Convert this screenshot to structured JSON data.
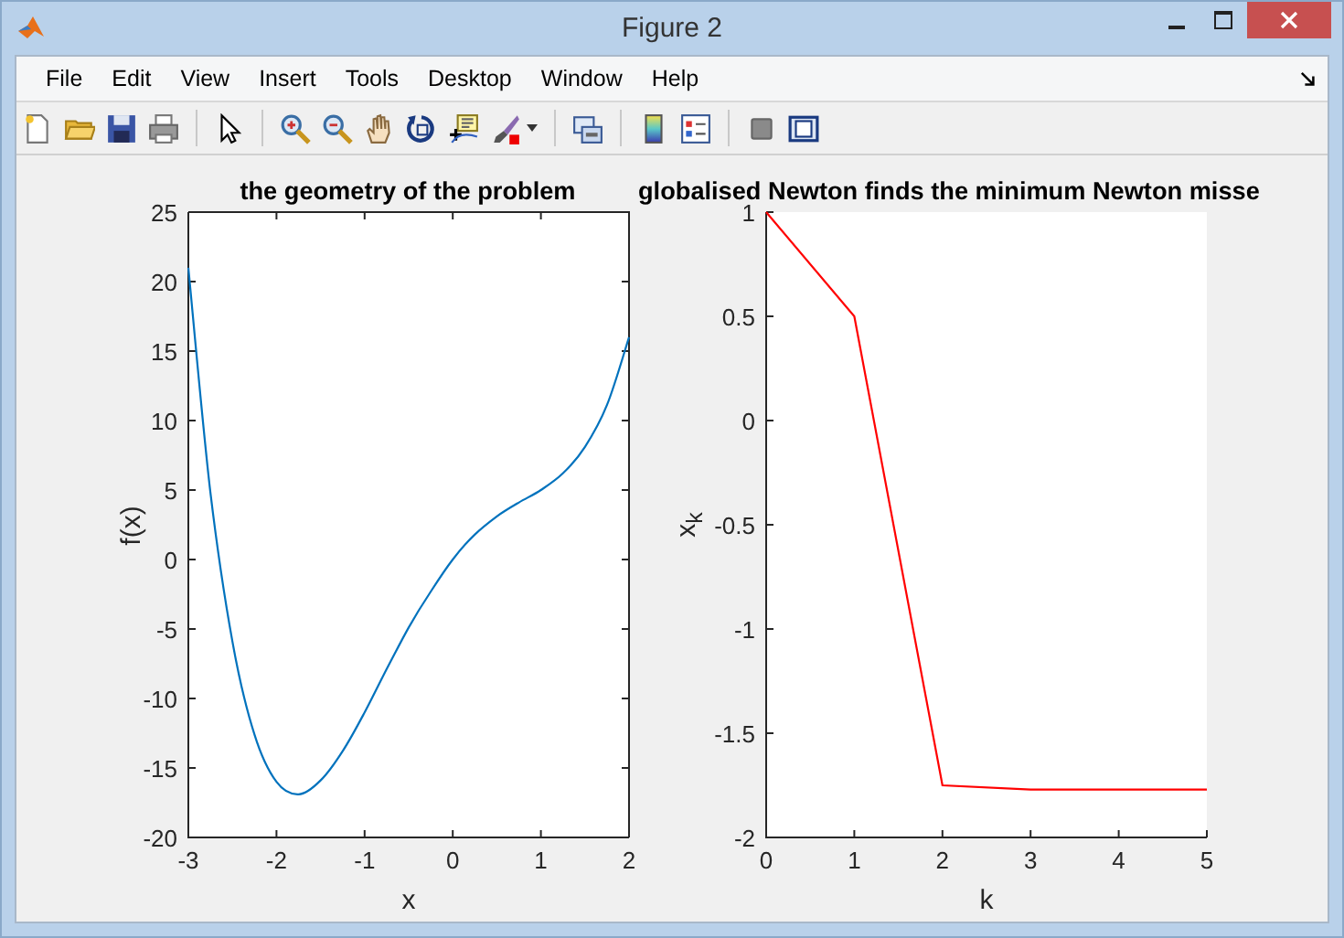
{
  "window": {
    "title": "Figure 2"
  },
  "menu": [
    "File",
    "Edit",
    "View",
    "Insert",
    "Tools",
    "Desktop",
    "Window",
    "Help"
  ],
  "plots": [
    {
      "chart_data": {
        "type": "line",
        "title": "the geometry of the problem",
        "xlabel": "x",
        "ylabel": "f(x)",
        "x": [
          -3,
          -2.75,
          -2.5,
          -2.25,
          -2,
          -1.75,
          -1.5,
          -1.25,
          -1,
          -0.75,
          -0.5,
          -0.25,
          0,
          0.25,
          0.5,
          0.75,
          1,
          1.25,
          1.5,
          1.75,
          2
        ],
        "series": [
          {
            "color": "#0072bd",
            "values": [
              21,
              4.9,
              -5.9,
              -12.6,
              -16,
              -16.9,
              -15.9,
              -13.8,
              -11,
              -7.9,
              -4.9,
              -2.3,
              0,
              1.8,
              3.1,
              4.1,
              5,
              6.2,
              8.1,
              11.1,
              16
            ]
          }
        ],
        "xlim": [
          -3,
          2
        ],
        "ylim": [
          -20,
          25
        ],
        "xticks": [
          -3,
          -2,
          -1,
          0,
          1,
          2
        ],
        "yticks": [
          -20,
          -15,
          -10,
          -5,
          0,
          5,
          10,
          15,
          20,
          25
        ]
      }
    },
    {
      "chart_data": {
        "type": "line",
        "title": "globalised Newton finds the minimum Newton misse",
        "xlabel": "k",
        "ylabel": "x$_{k}$",
        "x": [
          0,
          1,
          2,
          3,
          4,
          5
        ],
        "series": [
          {
            "color": "#ff0000",
            "values": [
              1,
              0.5,
              -1.75,
              -1.77,
              -1.77,
              -1.77
            ]
          }
        ],
        "xlim": [
          0,
          5
        ],
        "ylim": [
          -2,
          1
        ],
        "xticks": [
          0,
          1,
          2,
          3,
          4,
          5
        ],
        "yticks": [
          -2,
          -1.5,
          -1,
          -0.5,
          0,
          0.5,
          1
        ]
      }
    }
  ]
}
